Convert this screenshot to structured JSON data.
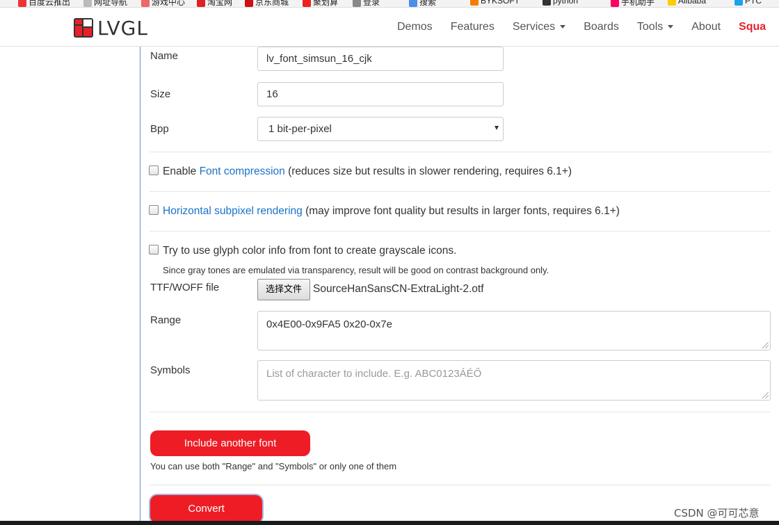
{
  "bookmarks": [
    "百度云推出",
    "网址导航",
    "游戏中心",
    "淘宝网",
    "京东商城",
    "聚划算",
    "登录",
    "搜索",
    "BYKSOFT",
    "python",
    "手机助手",
    "Alibaba",
    "PTC"
  ],
  "brand": {
    "name": "LVGL"
  },
  "nav": {
    "items": [
      {
        "label": "Demos"
      },
      {
        "label": "Features"
      },
      {
        "label": "Services"
      },
      {
        "label": "Boards"
      },
      {
        "label": "Tools"
      },
      {
        "label": "About"
      },
      {
        "label": "Squa"
      }
    ]
  },
  "form": {
    "name_label": "Name",
    "name_value": "lv_font_simsun_16_cjk",
    "size_label": "Size",
    "size_value": "16",
    "bpp_label": "Bpp",
    "bpp_value": "1 bit-per-pixel",
    "compression": {
      "prefix": "Enable ",
      "link": "Font compression",
      "suffix": " (reduces size but results in slower rendering, requires 6.1+)"
    },
    "subpixel": {
      "link": "Horizontal subpixel rendering",
      "suffix": " (may improve font quality but results in larger fonts, requires 6.1+)"
    },
    "grayscale_label": "Try to use glyph color info from font to create grayscale icons.",
    "grayscale_help": "Since gray tones are emulated via transparency, result will be good on contrast background only.",
    "file_label": "TTF/WOFF file",
    "file_button": "选择文件",
    "file_name": "SourceHanSansCN-ExtraLight-2.otf",
    "range_label": "Range",
    "range_value": "0x4E00-0x9FA5 0x20-0x7e",
    "symbols_label": "Symbols",
    "symbols_placeholder": "List of character to include. E.g. ABC0123ÁÉŐ",
    "include_button": "Include another font",
    "include_help": "You can use both \"Range\" and \"Symbols\" or only one of them",
    "convert_button": "Convert"
  },
  "watermark": "CSDN @可可芯意",
  "colors": {
    "accent_red": "#ee1d25",
    "link_blue": "#1a73c9"
  }
}
